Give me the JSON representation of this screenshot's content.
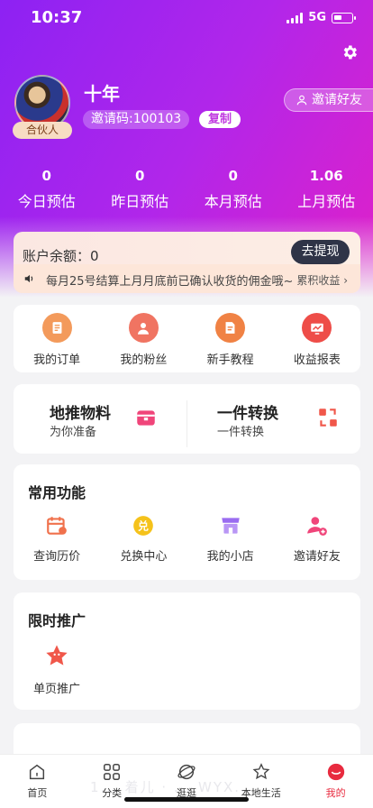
{
  "status_bar": {
    "time": "10:37",
    "network": "5G"
  },
  "profile": {
    "username": "十年",
    "role_badge": "合伙人",
    "invite_code": "邀请码:100103",
    "copy_label": "复制",
    "invite_friends_label": "邀请好友"
  },
  "stats": [
    {
      "value": "0",
      "label": "今日预估"
    },
    {
      "value": "0",
      "label": "昨日预估"
    },
    {
      "value": "0",
      "label": "本月预估"
    },
    {
      "value": "1.06",
      "label": "上月预估"
    }
  ],
  "balance": {
    "label": "账户余额：0",
    "withdraw_label": "去提现",
    "notice": "每月25号结算上月月底前已确认收货的佣金哦~",
    "accumulated_label": "累积收益 ›"
  },
  "quick_actions": [
    {
      "label": "我的订单",
      "icon": "order-icon",
      "color": "#f08a4b"
    },
    {
      "label": "我的粉丝",
      "icon": "fans-icon",
      "color": "#f06f5e"
    },
    {
      "label": "新手教程",
      "icon": "tutorial-icon",
      "color": "#f07f3f"
    },
    {
      "label": "收益报表",
      "icon": "report-icon",
      "color": "#ef4a45"
    }
  ],
  "promo": {
    "left": {
      "title": "地推物料",
      "subtitle": "为你准备"
    },
    "right": {
      "title": "一件转换",
      "subtitle": "一件转换"
    }
  },
  "common_functions": {
    "title": "常用功能",
    "items": [
      {
        "label": "查询历价",
        "icon": "calendar-icon",
        "color": "#f0714c"
      },
      {
        "label": "兑换中心",
        "icon": "exchange-icon",
        "color": "#f5c21b"
      },
      {
        "label": "我的小店",
        "icon": "shop-icon",
        "color": "#9a6cf0"
      },
      {
        "label": "邀请好友",
        "icon": "add-user-icon",
        "color": "#f0457a"
      }
    ]
  },
  "limited_promo": {
    "title": "限时推广",
    "items": [
      {
        "label": "单页推广",
        "icon": "star-icon",
        "color": "#f0574a"
      }
    ]
  },
  "tabbar": [
    {
      "label": "首页",
      "icon": "home-icon"
    },
    {
      "label": "分类",
      "icon": "category-icon"
    },
    {
      "label": "逛逛",
      "icon": "browse-icon"
    },
    {
      "label": "本地生活",
      "icon": "local-life-icon"
    },
    {
      "label": "我的",
      "icon": "profile-icon",
      "active": true
    }
  ],
  "watermark": "1... 着儿 · ... WYX..."
}
